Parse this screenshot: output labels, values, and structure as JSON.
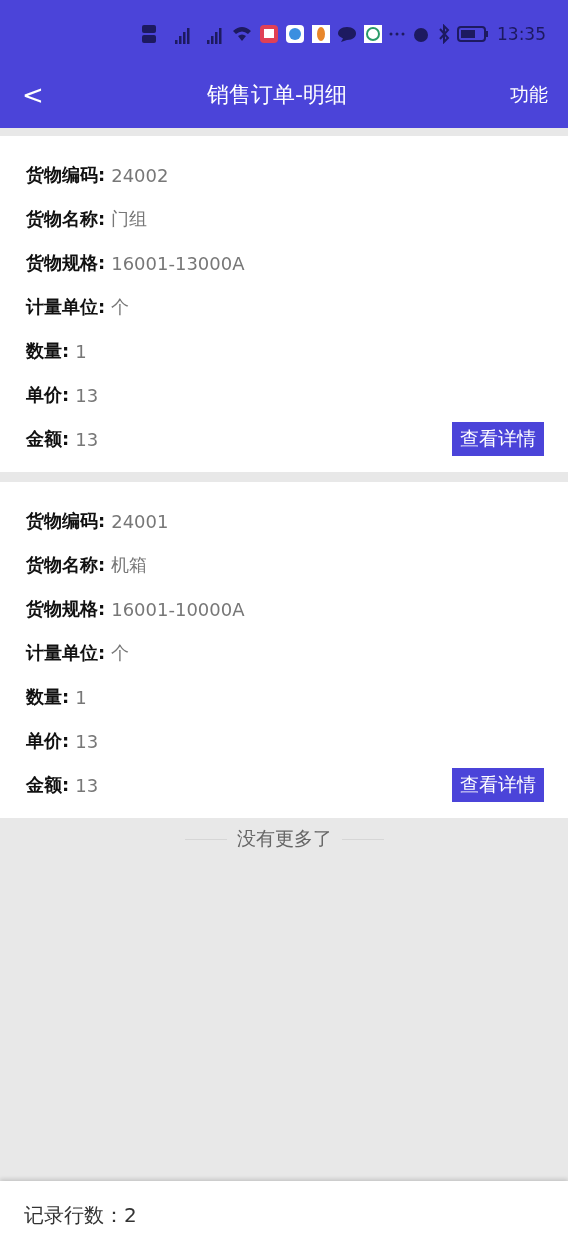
{
  "status_bar": {
    "time": "13:35"
  },
  "header": {
    "back": "<",
    "title": "销售订单-明细",
    "action": "功能"
  },
  "orders": [
    {
      "fields": [
        {
          "label": "货物编码:",
          "value": "24002"
        },
        {
          "label": "货物名称:",
          "value": "门组"
        },
        {
          "label": "货物规格:",
          "value": "16001-13000A"
        },
        {
          "label": "计量单位:",
          "value": "个"
        },
        {
          "label": "数量:",
          "value": "1"
        },
        {
          "label": "单价:",
          "value": "13"
        },
        {
          "label": "金额:",
          "value": "13"
        }
      ],
      "button": "查看详情"
    },
    {
      "fields": [
        {
          "label": "货物编码:",
          "value": "24001"
        },
        {
          "label": "货物名称:",
          "value": "机箱"
        },
        {
          "label": "货物规格:",
          "value": "16001-10000A"
        },
        {
          "label": "计量单位:",
          "value": "个"
        },
        {
          "label": "数量:",
          "value": "1"
        },
        {
          "label": "单价:",
          "value": "13"
        },
        {
          "label": "金额:",
          "value": "13"
        }
      ],
      "button": "查看详情"
    }
  ],
  "end_note": "没有更多了",
  "footer": {
    "record_count": "记录行数：2"
  }
}
